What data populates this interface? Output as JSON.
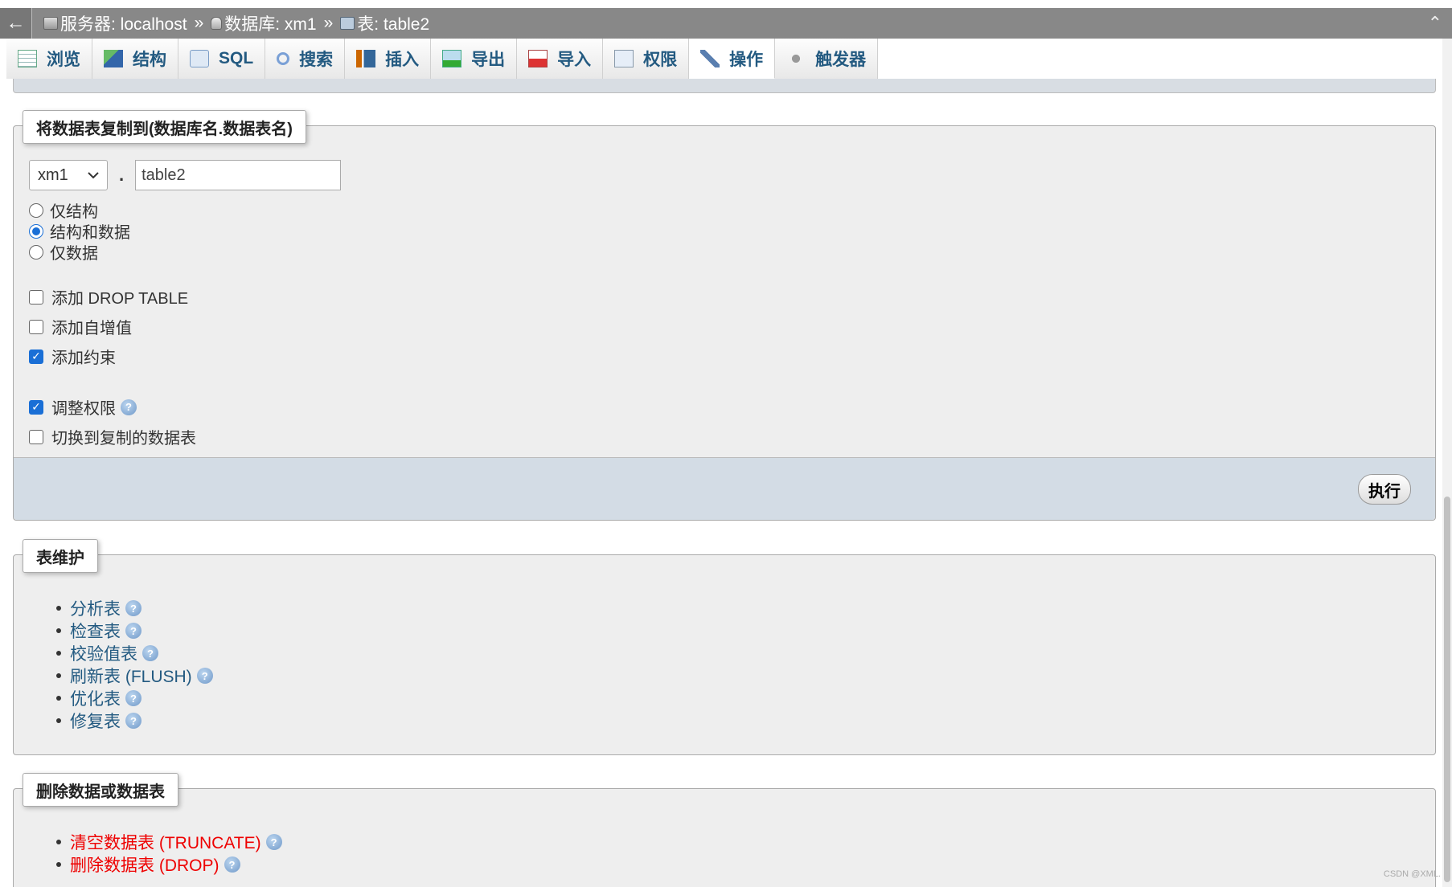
{
  "breadcrumb": {
    "back_icon": "←",
    "server": "服务器: localhost",
    "database": "数据库: xm1",
    "table": "表: table2",
    "separator": "»",
    "collapse_icon": "⌃"
  },
  "tabs": [
    {
      "label": "浏览",
      "icon": "browse-icon"
    },
    {
      "label": "结构",
      "icon": "structure-icon"
    },
    {
      "label": "SQL",
      "icon": "sql-icon"
    },
    {
      "label": "搜索",
      "icon": "search-icon"
    },
    {
      "label": "插入",
      "icon": "insert-icon"
    },
    {
      "label": "导出",
      "icon": "export-icon"
    },
    {
      "label": "导入",
      "icon": "import-icon"
    },
    {
      "label": "权限",
      "icon": "privileges-icon"
    },
    {
      "label": "操作",
      "icon": "operations-icon",
      "active": true
    },
    {
      "label": "触发器",
      "icon": "triggers-icon"
    }
  ],
  "copy_table": {
    "legend": "将数据表复制到(数据库名.数据表名)",
    "db_select_value": "xm1",
    "dot": ".",
    "table_name_value": "table2",
    "options": [
      {
        "label": "仅结构",
        "checked": false
      },
      {
        "label": "结构和数据",
        "checked": true
      },
      {
        "label": "仅数据",
        "checked": false
      }
    ],
    "checkboxes": [
      {
        "label": "添加 DROP TABLE",
        "checked": false
      },
      {
        "label": "添加自增值",
        "checked": false
      },
      {
        "label": "添加约束",
        "checked": true
      },
      {
        "label": "调整权限",
        "checked": true,
        "help": true
      },
      {
        "label": "切换到复制的数据表",
        "checked": false
      }
    ],
    "go_label": "执行"
  },
  "maintenance": {
    "legend": "表维护",
    "items": [
      {
        "label": "分析表"
      },
      {
        "label": "检查表"
      },
      {
        "label": "校验值表"
      },
      {
        "label": "刷新表 (FLUSH)"
      },
      {
        "label": "优化表"
      },
      {
        "label": "修复表"
      }
    ]
  },
  "delete": {
    "legend": "删除数据或数据表",
    "items": [
      {
        "label": "清空数据表 (TRUNCATE)"
      },
      {
        "label": "删除数据表 (DROP)"
      }
    ]
  },
  "help_glyph": "?",
  "check_glyph": "✓",
  "watermark": "CSDN @XML."
}
